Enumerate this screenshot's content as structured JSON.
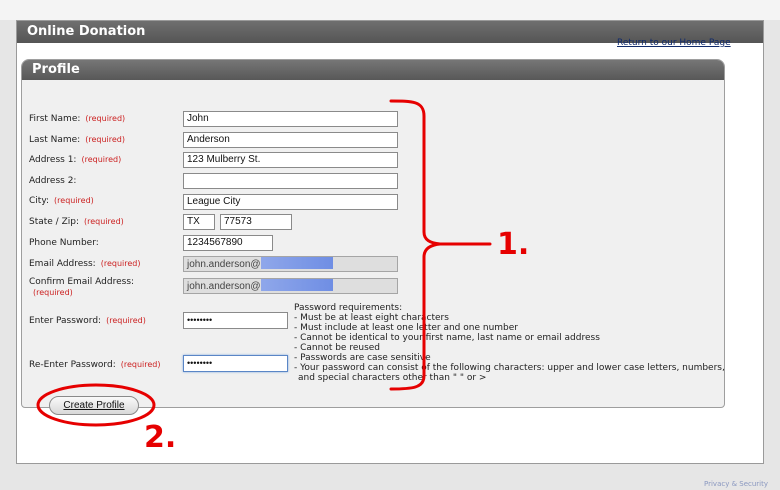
{
  "page": {
    "title": "Online Donation",
    "return_link": "Return to our Home Page"
  },
  "profile": {
    "title": "Profile",
    "required_tag": "(required)",
    "fields": [
      {
        "label": "First Name:",
        "required": true,
        "value": "John"
      },
      {
        "label": "Last Name:",
        "required": true,
        "value": "Anderson"
      },
      {
        "label": "Address 1:",
        "required": true,
        "value": "123 Mulberry St."
      },
      {
        "label": "Address 2:",
        "required": false,
        "value": ""
      },
      {
        "label": "City:",
        "required": true,
        "value": "League City"
      },
      {
        "label": "State / Zip:",
        "required": true,
        "state": "TX",
        "zip": "77573"
      },
      {
        "label": "Phone Number:",
        "required": false,
        "value": "1234567890"
      },
      {
        "label": "Email Address:",
        "required": true,
        "value": "john.anderson@"
      },
      {
        "label": "Confirm Email Address:",
        "required": true,
        "value": "john.anderson@"
      },
      {
        "label": "Enter Password:",
        "required": true,
        "value": "••••••••"
      },
      {
        "label": "Re-Enter Password:",
        "required": true,
        "value": "••••••••"
      }
    ],
    "password_requirements": [
      "Password requirements:",
      "- Must be at least eight characters",
      "- Must include at least one letter and one number",
      "- Cannot be identical to your first name, last name or email address",
      "- Cannot be reused",
      "- Passwords are case sensitive",
      "- Your password can consist of the following characters: upper and lower case letters, numbers,",
      "  and special characters other than \" \" or >"
    ],
    "create_button": "Create Profile"
  },
  "annotations": {
    "step1": "1.",
    "step2": "2.",
    "color": "#e60000"
  },
  "footer": {
    "link": "Privacy & Security"
  }
}
